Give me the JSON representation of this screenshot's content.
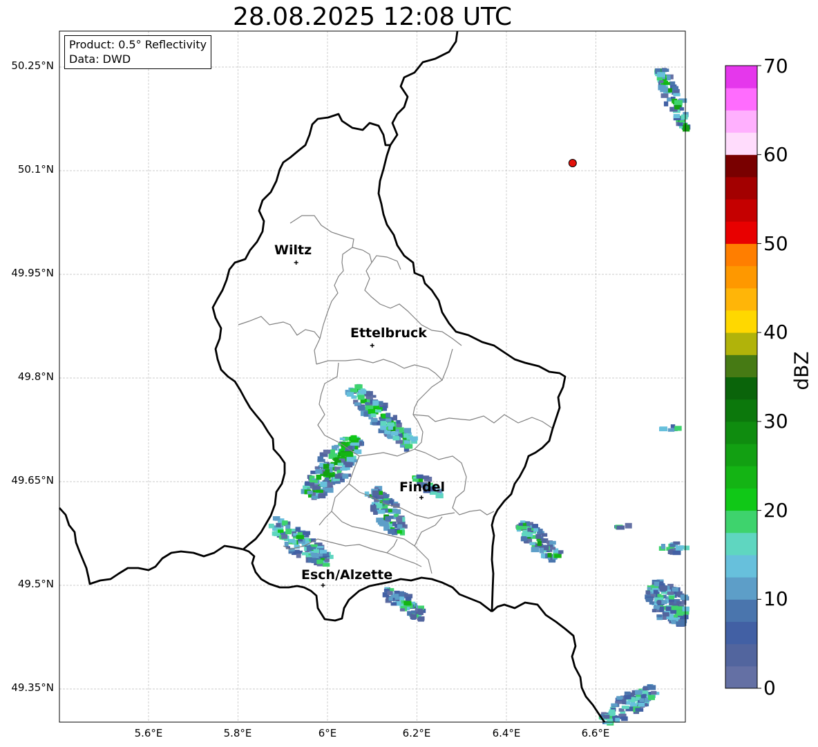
{
  "title": "28.08.2025 12:08 UTC",
  "info": {
    "product": "Product: 0.5° Reflectivity",
    "source": "Data: DWD"
  },
  "lat_labels": [
    "50.25°N",
    "50.1°N",
    "49.95°N",
    "49.8°N",
    "49.65°N",
    "49.5°N",
    "49.35°N"
  ],
  "lon_labels": [
    "5.6°E",
    "5.8°E",
    "6°E",
    "6.2°E",
    "6.4°E",
    "6.6°E"
  ],
  "cities": [
    {
      "name": "Wiltz",
      "lon": 5.93,
      "lat": 49.967
    },
    {
      "name": "Ettelbruck",
      "lon": 6.1,
      "lat": 49.847
    },
    {
      "name": "Findel",
      "lon": 6.21,
      "lat": 49.627
    },
    {
      "name": "Esch/Alzette",
      "lon": 5.99,
      "lat": 49.5
    }
  ],
  "radar_site": {
    "lon": 6.548,
    "lat": 50.111,
    "color": "#e3120b"
  },
  "colorbar": {
    "label": "dBZ",
    "ticks": [
      "0",
      "10",
      "20",
      "30",
      "40",
      "50",
      "60",
      "70"
    ],
    "colors": [
      "#6470a4",
      "#52659e",
      "#4260a4",
      "#4a75ad",
      "#5d9ec8",
      "#67c0dc",
      "#5fd6c0",
      "#3ed36d",
      "#10c817",
      "#14b414",
      "#12a012",
      "#0f8c0f",
      "#0c780c",
      "#0a640a",
      "#467a14",
      "#b1b30a",
      "#ffd800",
      "#ffb508",
      "#fe9800",
      "#ff7e00",
      "#e80000",
      "#c50000",
      "#a30000",
      "#790000",
      "#ffdcfc",
      "#ffb0fe",
      "#ff6cfe",
      "#e537ec"
    ]
  }
}
